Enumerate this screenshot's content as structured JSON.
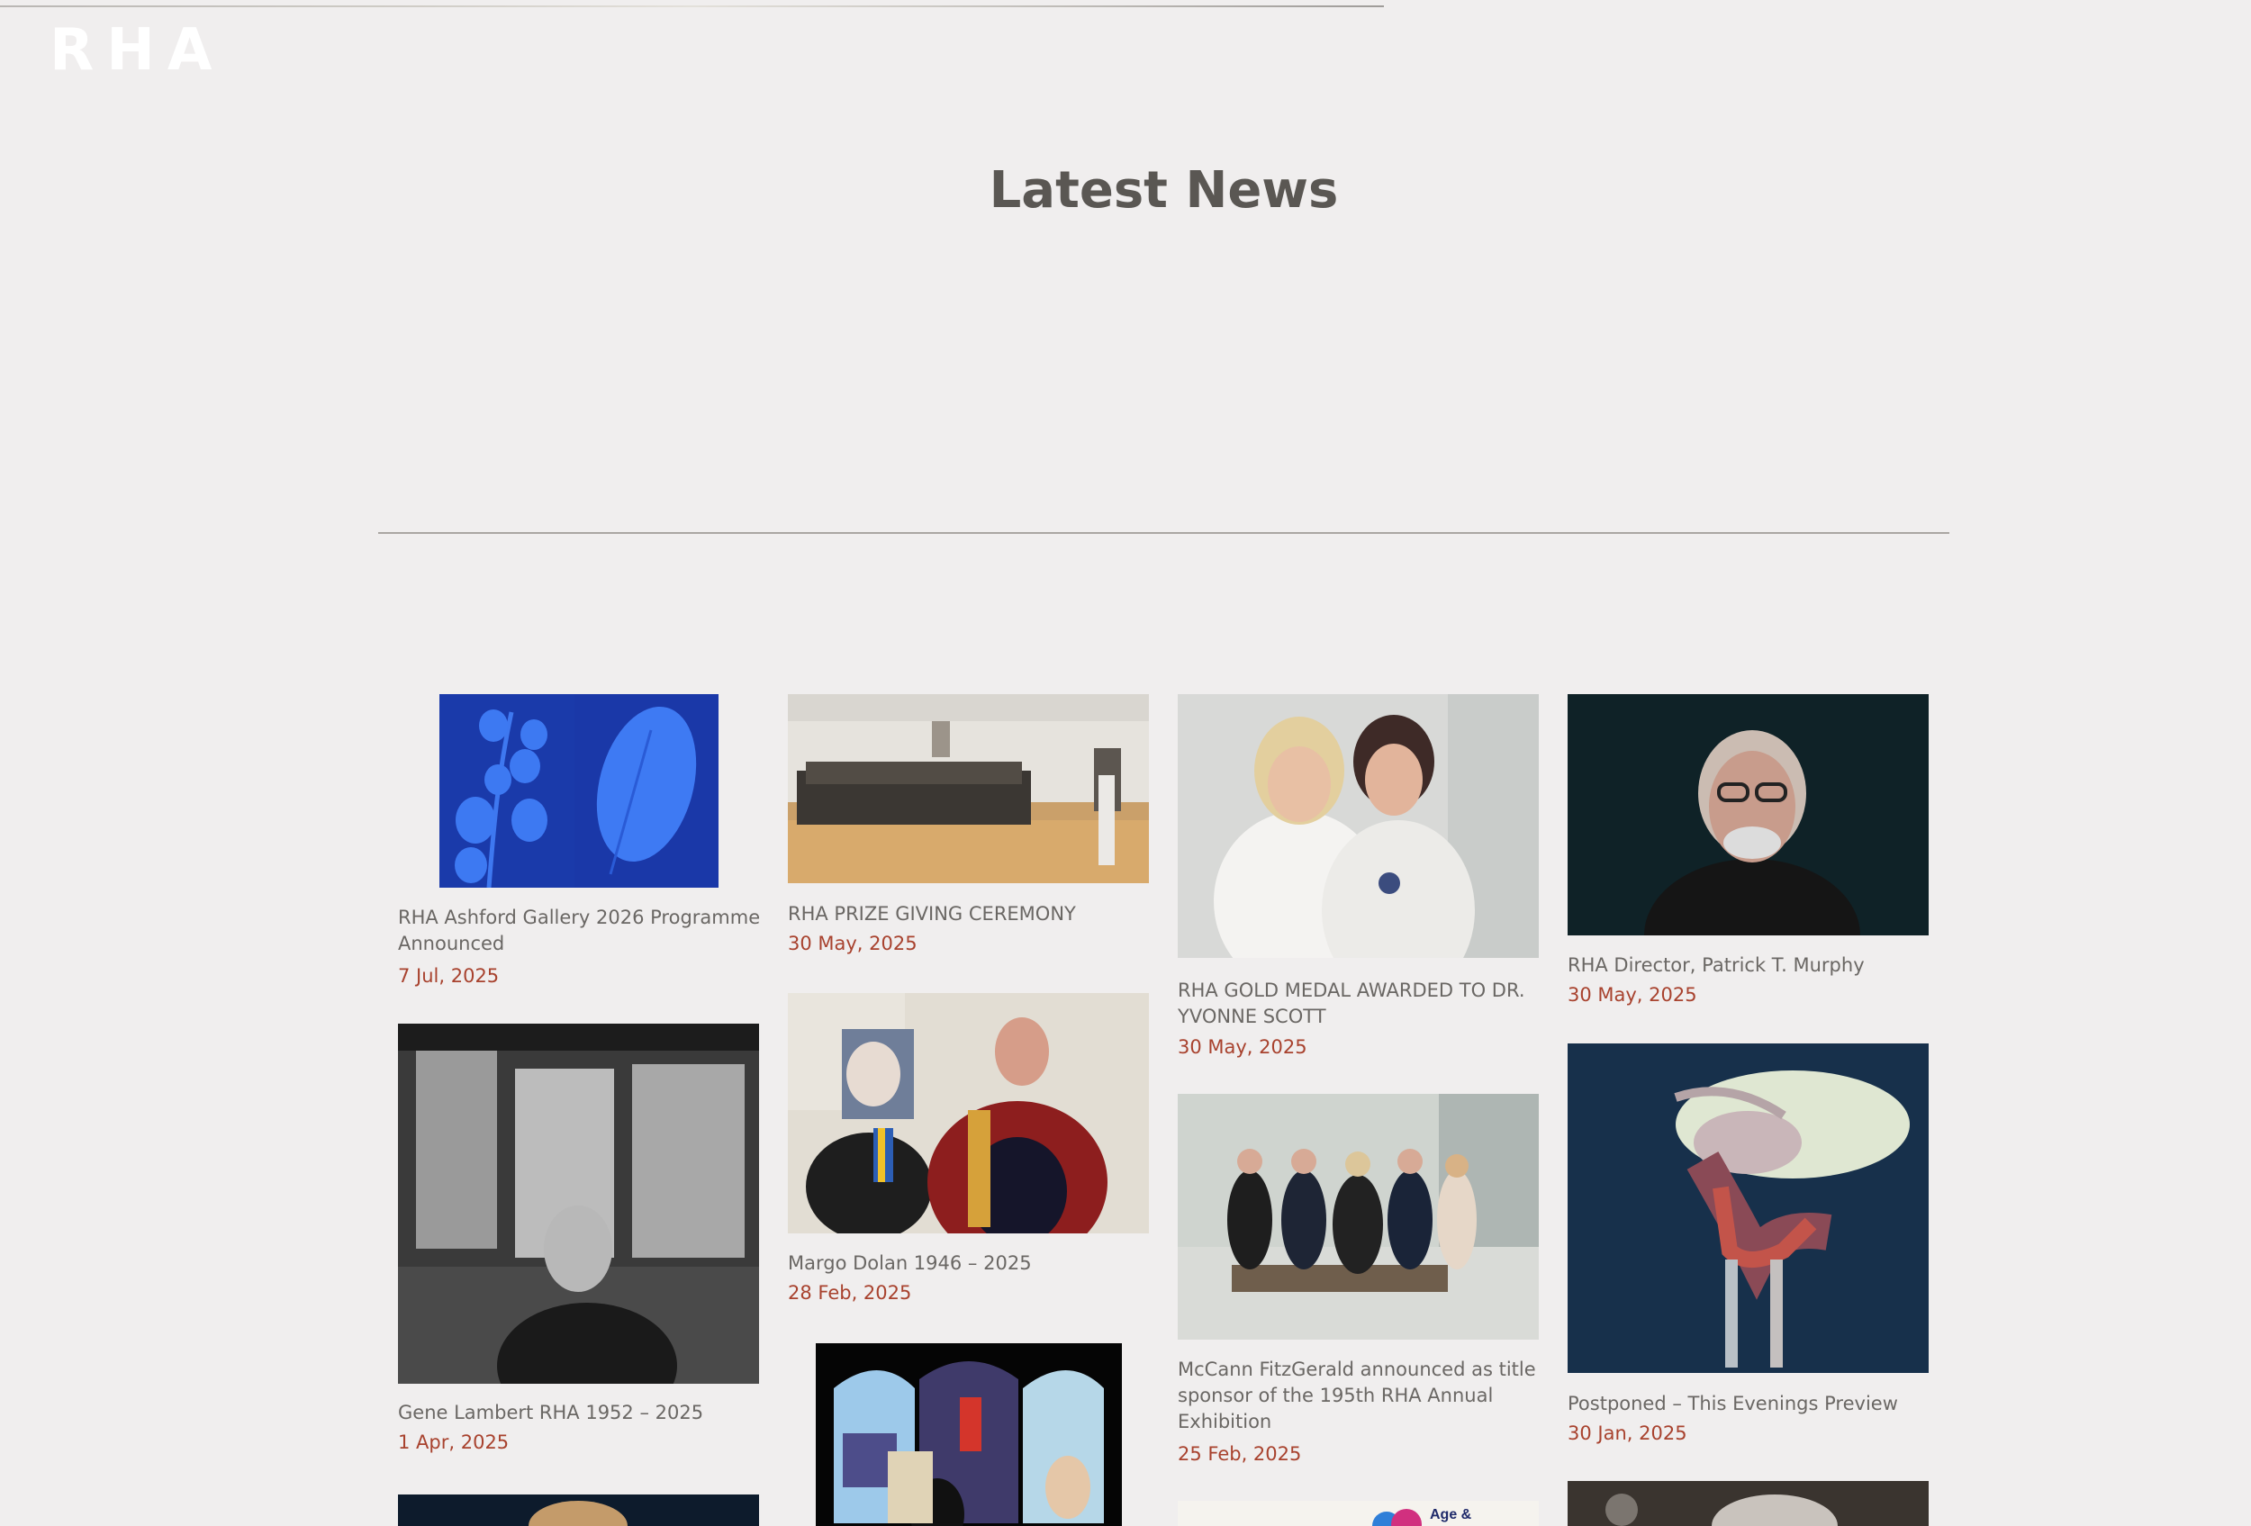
{
  "header": {
    "logo_text": "RHA"
  },
  "page": {
    "title": "Latest News"
  },
  "news": [
    {
      "title": "RHA Ashford Gallery 2026 Programme Announced",
      "date": "7 Jul, 2025"
    },
    {
      "title": "RHA PRIZE GIVING CEREMONY",
      "date": "30 May, 2025"
    },
    {
      "title": "RHA GOLD MEDAL AWARDED TO DR. YVONNE SCOTT",
      "date": "30 May, 2025"
    },
    {
      "title": "RHA Director, Patrick T. Murphy",
      "date": "30 May, 2025"
    },
    {
      "title": "Gene Lambert RHA 1952 – 2025",
      "date": "1 Apr, 2025"
    },
    {
      "title": "Margo Dolan 1946 – 2025",
      "date": "28 Feb, 2025"
    },
    {
      "title": "McCann FitzGerald announced as title sponsor of the 195th RHA Annual Exhibition",
      "date": "25 Feb, 2025"
    },
    {
      "title": "Postponed – This Evenings Preview",
      "date": "30 Jan, 2025"
    }
  ],
  "partial_thumb": {
    "text": "Age &"
  }
}
